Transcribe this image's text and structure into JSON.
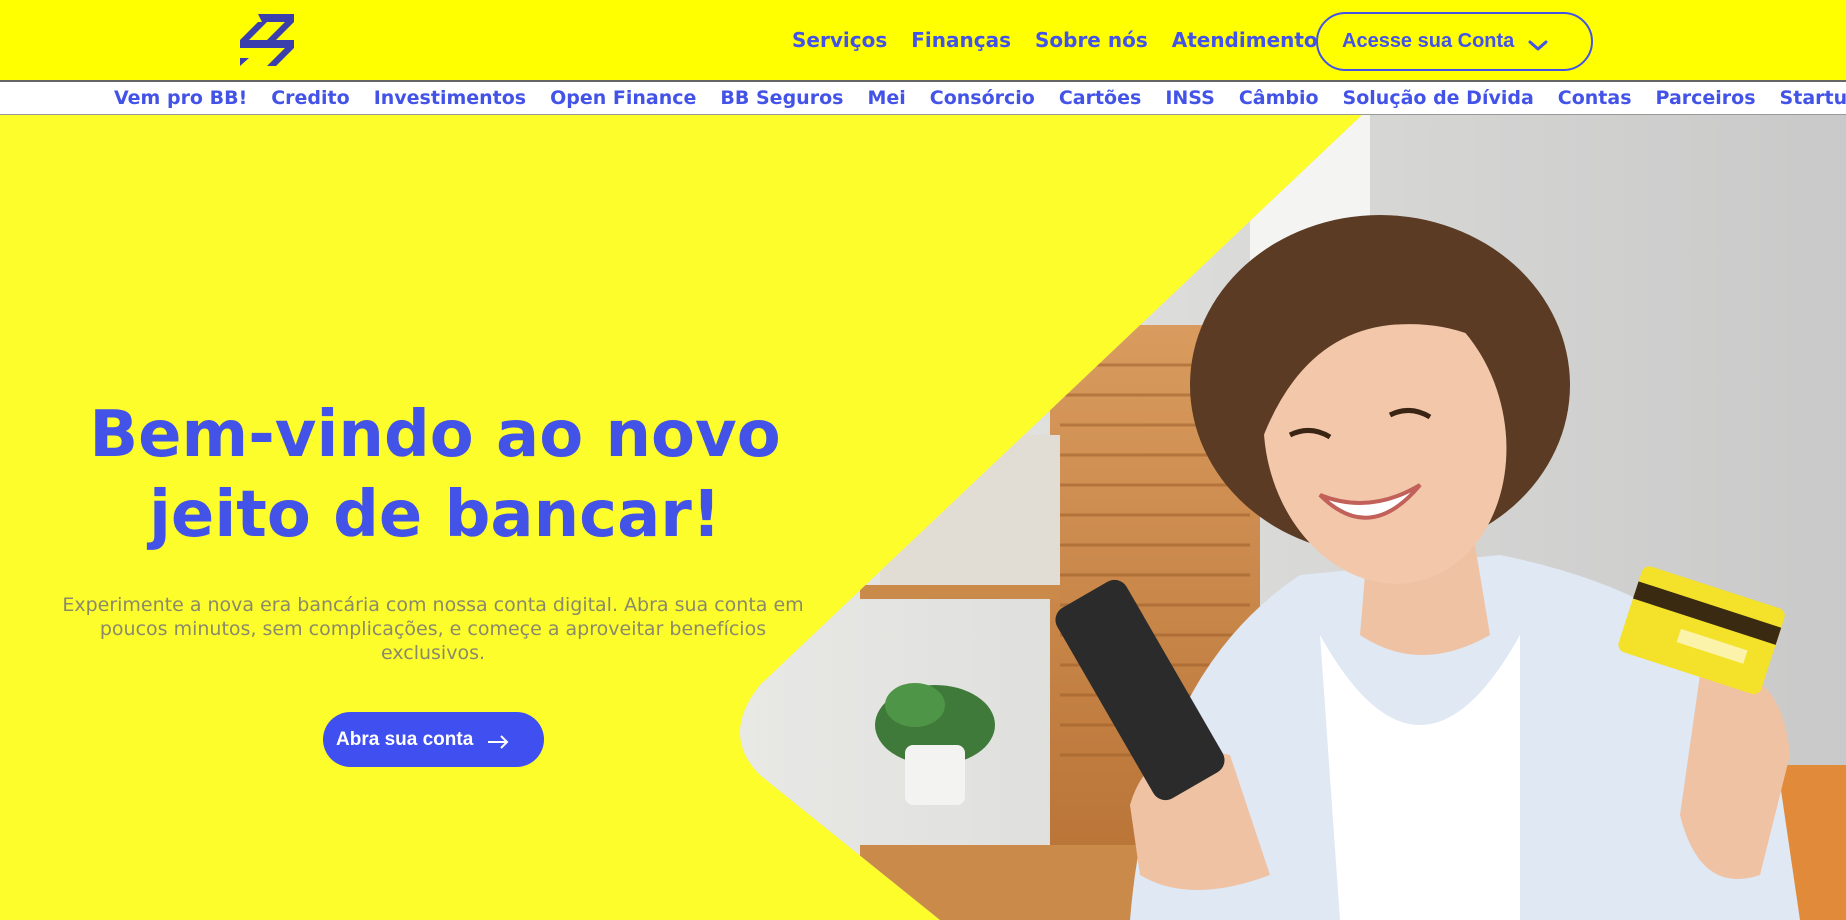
{
  "brand": {
    "logo_icon": "bb-logo-icon",
    "accent": "#4353e8",
    "background": "#ffff00"
  },
  "header": {
    "nav": [
      "Serviços",
      "Finanças",
      "Sobre nós",
      "Atendimento"
    ],
    "account_button": "Acesse sua Conta"
  },
  "subnav": {
    "items": [
      "Vem pro BB!",
      "Credito",
      "Investimentos",
      "Open Finance",
      "BB Seguros",
      "Mei",
      "Consórcio",
      "Cartões",
      "INSS",
      "Câmbio",
      "Solução de Dívida",
      "Contas",
      "Parceiros",
      "Startups"
    ]
  },
  "hero": {
    "title_line1": "Bem-vindo ao novo",
    "title_line2": "jeito de bancar!",
    "subtitle": "Experimente a nova era bancária com nossa conta digital. Abra sua conta em poucos minutos, sem complicações, e começe a aproveitar benefícios exclusivos.",
    "cta_label": "Abra sua conta",
    "image": "woman-with-phone-and-card-photo"
  }
}
